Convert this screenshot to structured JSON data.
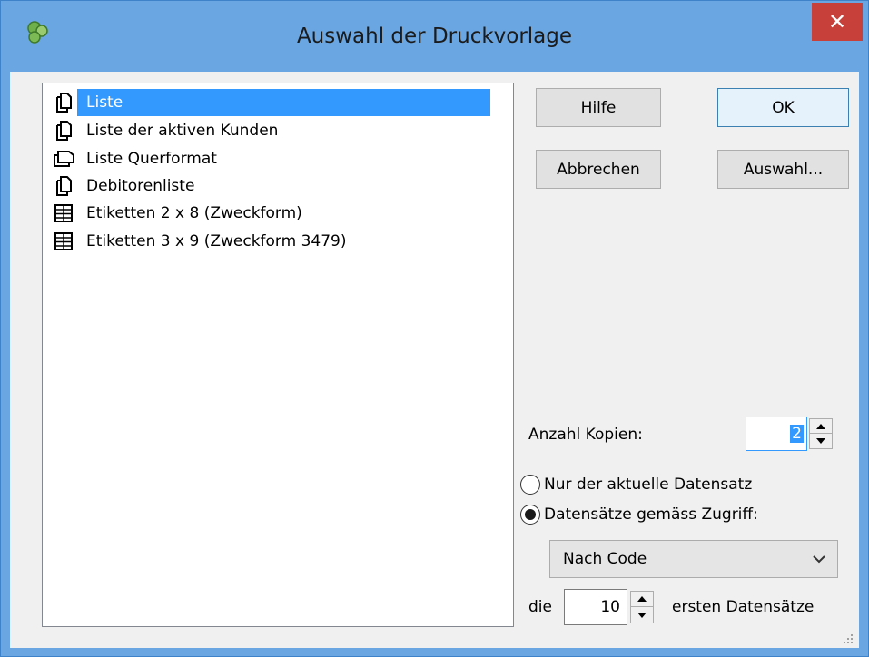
{
  "window": {
    "title": "Auswahl der Druckvorlage",
    "close_label": "✕",
    "app_icon": "app-icon-green-circles"
  },
  "list": {
    "items": [
      {
        "label": "Liste",
        "icon": "portrait-page-icon",
        "selected": true
      },
      {
        "label": "Liste der aktiven Kunden",
        "icon": "portrait-page-icon",
        "selected": false
      },
      {
        "label": "Liste Querformat",
        "icon": "landscape-page-icon",
        "selected": false
      },
      {
        "label": "Debitorenliste",
        "icon": "portrait-page-icon",
        "selected": false
      },
      {
        "label": "Etiketten 2 x 8 (Zweckform)",
        "icon": "label-grid-icon",
        "selected": false
      },
      {
        "label": "Etiketten 3 x 9 (Zweckform 3479)",
        "icon": "label-grid-icon",
        "selected": false
      }
    ]
  },
  "buttons": {
    "help": "Hilfe",
    "ok": "OK",
    "cancel": "Abbrechen",
    "select": "Auswahl..."
  },
  "copies": {
    "label": "Anzahl Kopien:",
    "value": "2"
  },
  "scope": {
    "option_current": "Nur der aktuelle Datensatz",
    "option_access": "Datensätze gemäss Zugriff:",
    "selected": "option_access",
    "sort_value": "Nach Code"
  },
  "limit": {
    "prefix": "die",
    "value": "10",
    "suffix": "ersten Datensätze"
  },
  "colors": {
    "titlebar": "#6aa6e2",
    "selection": "#3399ff",
    "close": "#c7413a"
  }
}
